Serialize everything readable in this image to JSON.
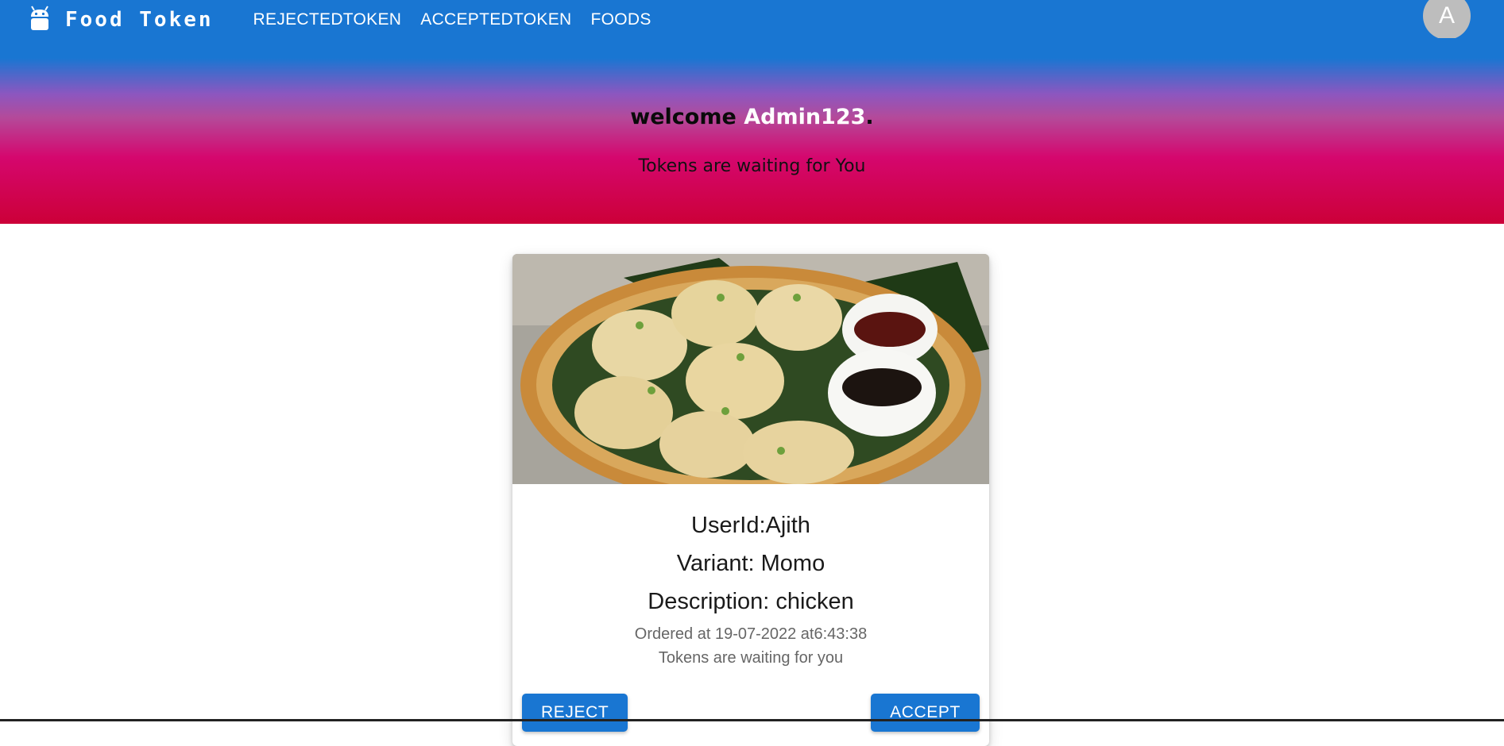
{
  "app": {
    "brand_title": "Food  Token",
    "brand_icon": "android-icon"
  },
  "nav": {
    "items": [
      {
        "label": "REJECTEDTOKEN"
      },
      {
        "label": "ACCEPTEDTOKEN"
      },
      {
        "label": "FOODS"
      }
    ]
  },
  "user": {
    "avatar_letter": "A"
  },
  "hero": {
    "welcome_prefix": "welcome ",
    "admin_name": "Admin123",
    "welcome_suffix": ".",
    "subtitle": "Tokens are waiting for You"
  },
  "card": {
    "image_alt": "momo-dumplings-photo",
    "userid": "UserId:Ajith",
    "variant": "Variant: Momo",
    "description": "Description: chicken",
    "ordered_at": "Ordered at 19-07-2022 at6:43:38",
    "status": "Tokens are waiting for you",
    "reject_label": "REJECT",
    "accept_label": "ACCEPT"
  },
  "colors": {
    "primary": "#1976d2",
    "hero_bottom": "#cc0038",
    "avatar_bg": "#bdbdbd"
  }
}
